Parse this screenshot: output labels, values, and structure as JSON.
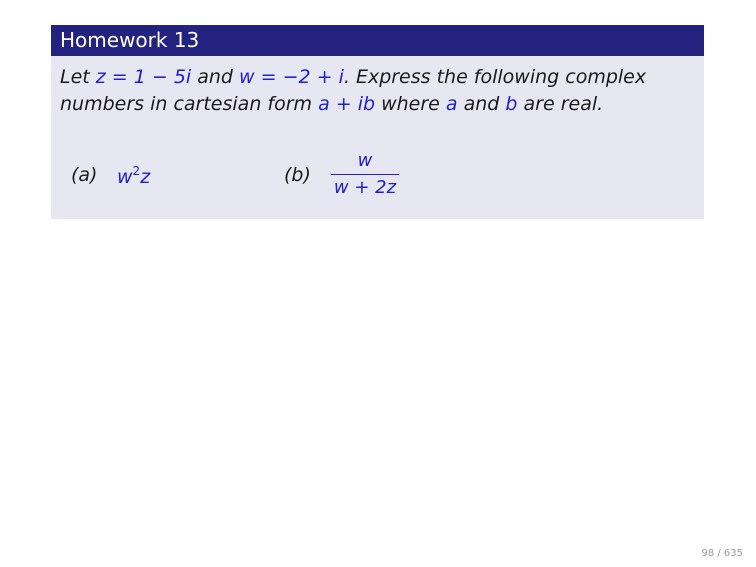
{
  "block": {
    "title": "Homework 13",
    "statement": {
      "t1": "Let ",
      "z_def": "z = 1 − 5i",
      "t2": " and ",
      "w_def": "w = −2 + i",
      "t3": ". Express the following complex numbers in cartesian form ",
      "form": "a + ib",
      "t4": " where ",
      "a": "a",
      "t5": " and ",
      "b": "b",
      "t6": " are real."
    },
    "items": [
      {
        "label": "(a)",
        "expr_base": "w",
        "expr_sup": "2",
        "expr_tail": "z"
      },
      {
        "label": "(b)",
        "numerator": "w",
        "denominator": "w + 2z"
      }
    ]
  },
  "footer": {
    "page_number": "98 / 635"
  },
  "colors": {
    "title_bar": "#23237f",
    "block_body": "#e7e7f2",
    "math": "#2020d0"
  }
}
